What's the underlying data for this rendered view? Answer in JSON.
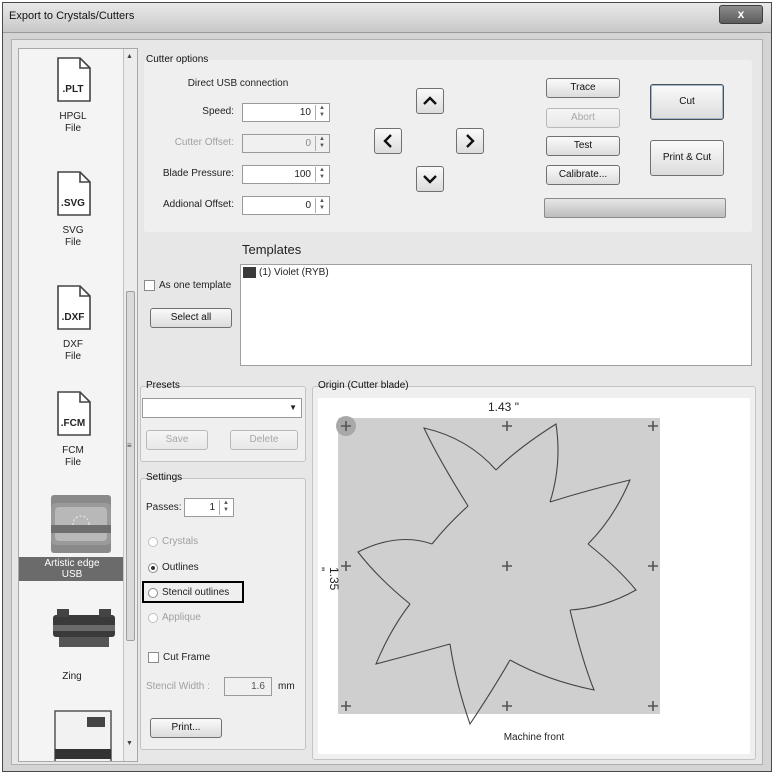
{
  "window": {
    "title": "Export to Crystals/Cutters",
    "close_label": "x"
  },
  "sidebar": {
    "files": [
      {
        "ext": ".PLT",
        "label1": "HPGL",
        "label2": "File"
      },
      {
        "ext": ".SVG",
        "label1": "SVG",
        "label2": "File"
      },
      {
        "ext": ".DXF",
        "label1": "DXF",
        "label2": "File"
      },
      {
        "ext": ".FCM",
        "label1": "FCM",
        "label2": "File"
      }
    ],
    "devices": [
      {
        "label1": "Artistic edge",
        "label2": "USB"
      },
      {
        "label1": "Zing",
        "label2": ""
      }
    ]
  },
  "cutter_options": {
    "title": "Cutter options",
    "connection": "Direct USB connection",
    "speed": {
      "label": "Speed:",
      "value": "10"
    },
    "cutter_offset": {
      "label": "Cutter Offset:",
      "value": "0"
    },
    "blade_pressure": {
      "label": "Blade Pressure:",
      "value": "100"
    },
    "additional_offset": {
      "label": "Addional Offset:",
      "value": "0"
    },
    "buttons": {
      "trace": "Trace",
      "abort": "Abort",
      "test": "Test",
      "calibrate": "Calibrate...",
      "cut": "Cut",
      "print_cut": "Print & Cut"
    },
    "progress": 0
  },
  "templates": {
    "title": "Templates",
    "as_one_template": "As one template",
    "select_all": "Select all",
    "items": [
      {
        "label": "(1) Violet (RYB)",
        "color": "#3a3a3a"
      }
    ]
  },
  "presets": {
    "title": "Presets",
    "selected": "",
    "save": "Save",
    "delete": "Delete"
  },
  "settings": {
    "title": "Settings",
    "passes": {
      "label": "Passes:",
      "value": "1"
    },
    "modes": [
      {
        "label": "Crystals",
        "checked": false,
        "enabled": false
      },
      {
        "label": "Outlines",
        "checked": true,
        "enabled": true
      },
      {
        "label": "Stencil outlines",
        "checked": false,
        "enabled": true
      },
      {
        "label": "Applique",
        "checked": false,
        "enabled": false
      }
    ],
    "cut_frame": "Cut Frame",
    "stencil_width": {
      "label": "Stencil Width :",
      "value": "1.6",
      "unit": "mm"
    },
    "print": "Print..."
  },
  "origin": {
    "title": "Origin (Cutter blade)",
    "width_label": "1.43 \"",
    "height_label": "1.35 \"",
    "footer": "Machine front"
  }
}
